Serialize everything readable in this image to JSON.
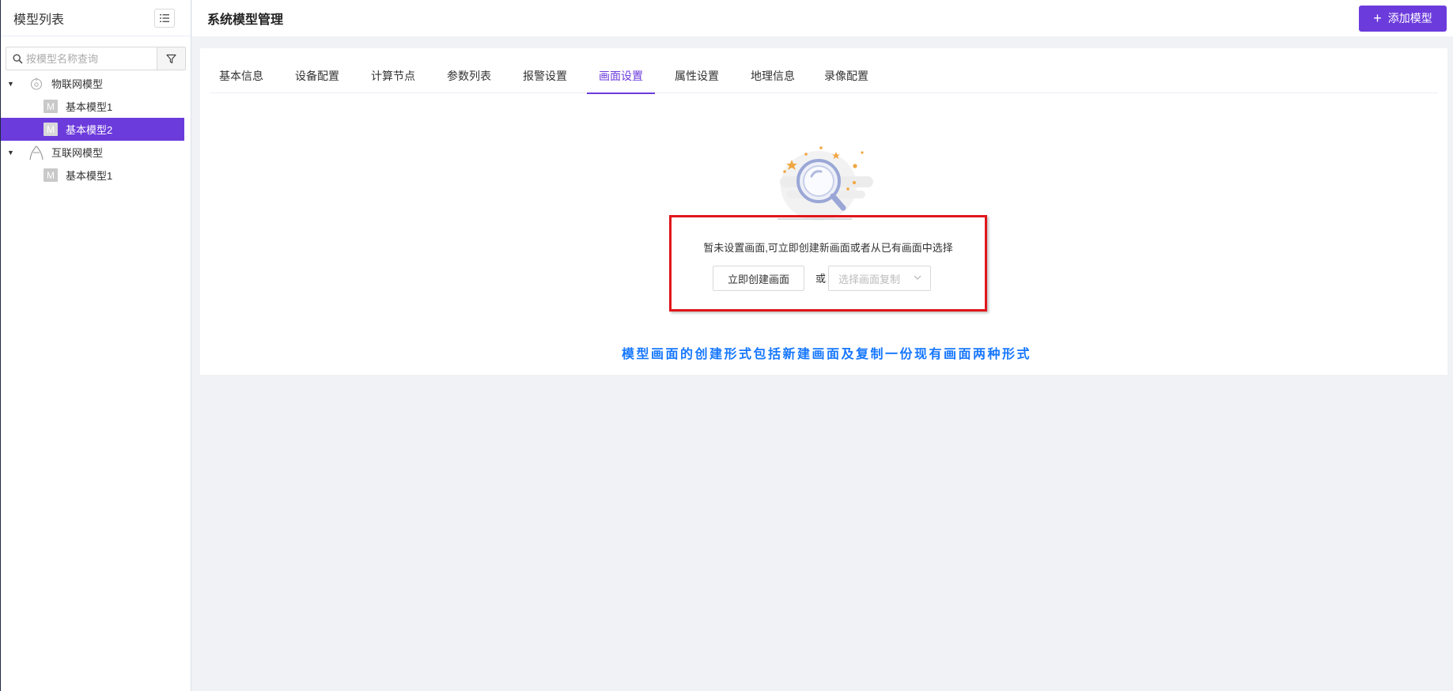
{
  "sidebar": {
    "title": "模型列表",
    "search_placeholder": "按模型名称查询",
    "groups": [
      {
        "label": "物联网模型",
        "icon": "iot-icon",
        "items": [
          {
            "icon_text": "M",
            "label": "基本模型1",
            "selected": false
          },
          {
            "icon_text": "M",
            "label": "基本模型2",
            "selected": true
          }
        ]
      },
      {
        "label": "互联网模型",
        "icon": "internet-icon",
        "items": [
          {
            "icon_text": "M",
            "label": "基本模型1",
            "selected": false
          }
        ]
      }
    ]
  },
  "header": {
    "title": "系统模型管理",
    "add_button": {
      "icon": "plus-icon",
      "label": "添加模型"
    }
  },
  "tabs": [
    "基本信息",
    "设备配置",
    "计算节点",
    "参数列表",
    "报警设置",
    "画面设置",
    "属性设置",
    "地理信息",
    "录像配置"
  ],
  "active_tab": "画面设置",
  "empty_state": {
    "message": "暂未设置画面,可立即创建新画面或者从已有画面中选择",
    "create_button": "立即创建画面",
    "or_label": "或",
    "select_placeholder": "选择画面复制"
  },
  "annotation": "模型画面的创建形式包括新建画面及复制一份现有画面两种形式",
  "colors": {
    "accent": "#6c3bdc",
    "highlight_border": "#e0161b",
    "annotation_text": "#1677ff"
  }
}
